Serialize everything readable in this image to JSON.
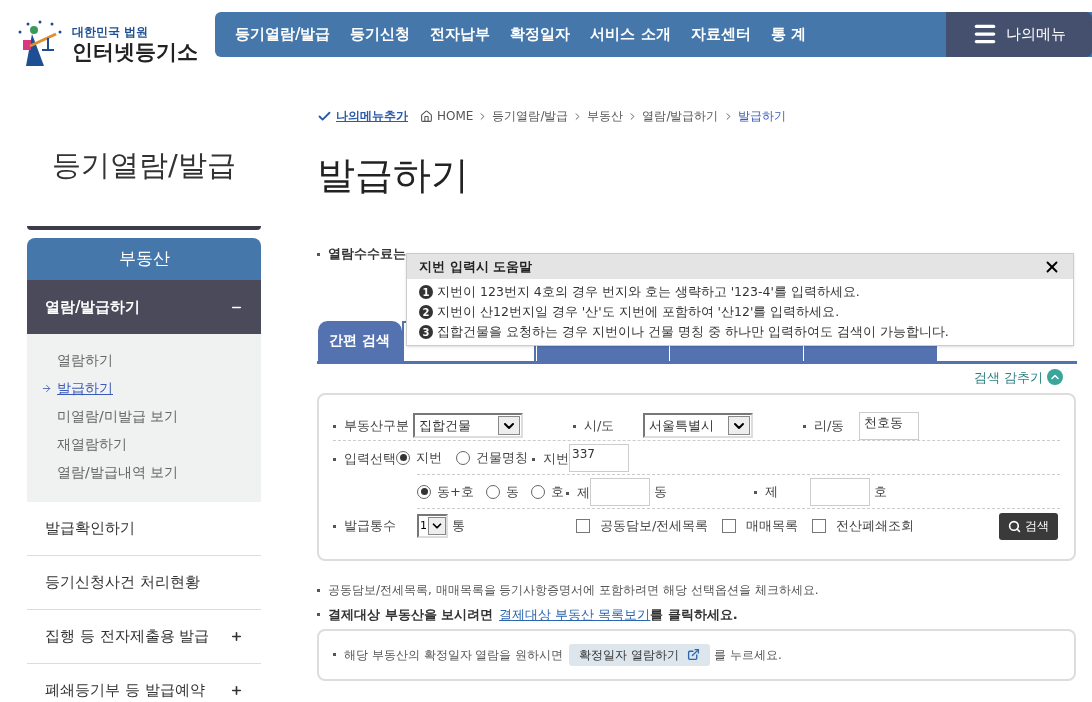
{
  "logo": {
    "org": "대한민국 법원",
    "name": "인터넷등기소"
  },
  "nav": {
    "items": [
      "등기열람/발급",
      "등기신청",
      "전자납부",
      "확정일자",
      "서비스 소개",
      "자료센터",
      "통 계"
    ],
    "my_menu": "나의메뉴"
  },
  "breadcrumb": {
    "add_menu": "나의메뉴추가",
    "items": [
      "HOME",
      "등기열람/발급",
      "부동산",
      "열람/발급하기",
      "발급하기"
    ]
  },
  "sidebar": {
    "title": "등기열람/발급",
    "category": "부동산",
    "items": [
      {
        "label": "열람/발급하기",
        "expanded": true,
        "expandable": true,
        "children": [
          {
            "label": "열람하기",
            "selected": false
          },
          {
            "label": "발급하기",
            "selected": true
          },
          {
            "label": "미열람/미발급 보기",
            "selected": false
          },
          {
            "label": "재열람하기",
            "selected": false
          },
          {
            "label": "열람/발급내역 보기",
            "selected": false
          }
        ]
      },
      {
        "label": "발급확인하기",
        "expanded": false,
        "expandable": false
      },
      {
        "label": "등기신청사건 처리현황",
        "expanded": false,
        "expandable": false
      },
      {
        "label": "집행 등 전자제출용 발급",
        "expanded": false,
        "expandable": true
      },
      {
        "label": "폐쇄등기부 등 발급예약",
        "expanded": false,
        "expandable": true
      }
    ]
  },
  "page_title": "발급하기",
  "fee_note": "열람수수료는",
  "tabs": [
    {
      "label": "간편 검색",
      "selected": false
    },
    {
      "selected": true
    },
    {
      "selected": false
    },
    {
      "selected": false
    },
    {
      "selected": false
    }
  ],
  "toggle_search": "검색 감추기",
  "help_popup": {
    "title": "지번 입력시 도움말",
    "items": [
      {
        "num": "1",
        "text": "지번이 123번지 4호의 경우 번지와 호는 생략하고 '123-4'를 입력하세요."
      },
      {
        "num": "2",
        "text": "지번이 산12번지일 경우 '산'도 지번에 포함하여 '산12'를 입력하세요."
      },
      {
        "num": "3",
        "text": "집합건물을 요청하는 경우 지번이나 건물 명칭 중 하나만 입력하여도 검색이 가능합니다."
      }
    ]
  },
  "form": {
    "property_type": {
      "label": "부동산구분",
      "value": "집합건물"
    },
    "city": {
      "label": "시/도",
      "value": "서울특별시"
    },
    "town": {
      "label": "리/동",
      "value": "천호동"
    },
    "input_choice": {
      "label": "입력선택",
      "options": [
        {
          "label": "지번",
          "selected": true
        },
        {
          "label": "건물명칭",
          "selected": false
        }
      ]
    },
    "lot": {
      "label": "지번",
      "value": "337"
    },
    "unit_choice": {
      "options": [
        {
          "label": "동+호",
          "selected": true
        },
        {
          "label": "동",
          "selected": false
        },
        {
          "label": "호",
          "selected": false
        }
      ]
    },
    "dong": {
      "label": "제",
      "suffix": "동"
    },
    "ho": {
      "label": "제",
      "suffix": "호"
    },
    "copies": {
      "label": "발급통수",
      "value": "1",
      "suffix": "통"
    },
    "options": [
      {
        "label": "공동담보/전세목록",
        "checked": false
      },
      {
        "label": "매매목록",
        "checked": false
      },
      {
        "label": "전산폐쇄조회",
        "checked": false
      }
    ],
    "search_button": "검색"
  },
  "notes": {
    "check_note": "공동담보/전세목록, 매매목록을 등기사항증명서에 포함하려면 해당 선택옵션을 체크하세요.",
    "list_prefix": "결제대상 부동산을 보시려면",
    "list_link": "결제대상 부동산 목록보기",
    "list_suffix": "를 클릭하세요."
  },
  "date_box": {
    "prefix": "해당 부동산의 확정일자 열람을 원하시면",
    "button": "확정일자 열람하기",
    "suffix": "를 누르세요."
  }
}
